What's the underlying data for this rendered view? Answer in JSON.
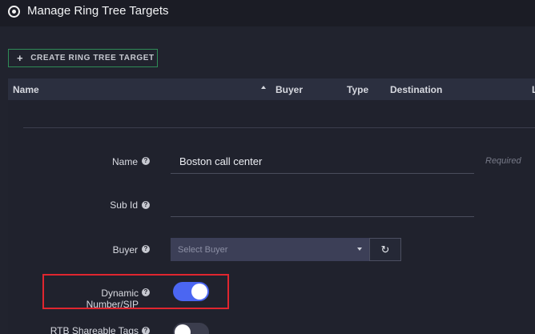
{
  "header": {
    "title": "Manage Ring Tree Targets",
    "icon": "target-icon"
  },
  "toolbar": {
    "create_label": "CREATE RING TREE TARGET",
    "create_icon": "+"
  },
  "table": {
    "columns": [
      "Name",
      "Buyer",
      "Type",
      "Destination",
      "L"
    ],
    "sort": {
      "column": "Name",
      "direction": "asc"
    }
  },
  "form": {
    "name": {
      "label": "Name",
      "value": "Boston call center",
      "hint": "Required"
    },
    "sub_id": {
      "label": "Sub Id",
      "value": ""
    },
    "buyer": {
      "label": "Buyer",
      "placeholder": "Select Buyer",
      "refresh_icon": "↻"
    },
    "dynamic_number": {
      "label": "Dynamic Number/SIP",
      "enabled": true
    },
    "rtb_tags": {
      "label": "RTB Shareable Tags",
      "enabled": false
    }
  },
  "help_icon": "?",
  "colors": {
    "accent": "#4b66f2",
    "create_border": "#2f8c57",
    "highlight": "#e0262f"
  }
}
